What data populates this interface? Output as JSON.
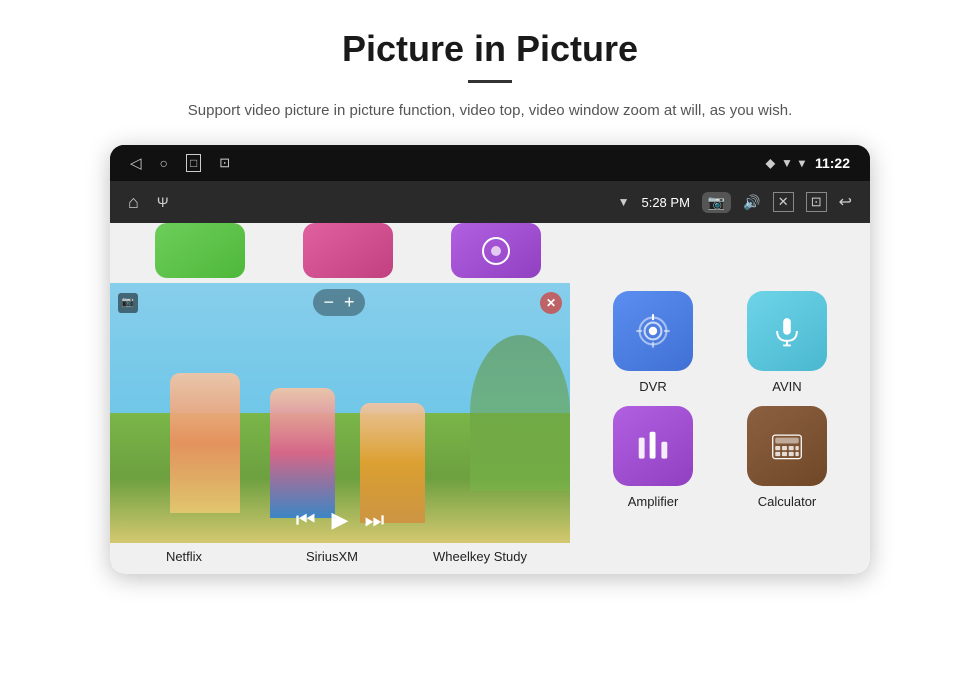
{
  "header": {
    "title": "Picture in Picture",
    "subtitle": "Support video picture in picture function, video top, video window zoom at will, as you wish."
  },
  "statusBar": {
    "time": "11:22",
    "toolbarTime": "5:28 PM"
  },
  "pipControls": {
    "minus": "−",
    "plus": "+",
    "close": "✕"
  },
  "apps": {
    "topRow": [
      {
        "label": "Netflix",
        "color": "green"
      },
      {
        "label": "SiriusXM",
        "color": "pink"
      },
      {
        "label": "Wheelkey Study",
        "color": "purple"
      }
    ],
    "bottomRow": [
      {
        "label": "DVR",
        "color": "dvr"
      },
      {
        "label": "AVIN",
        "color": "avin"
      }
    ],
    "secondBottomRow": [
      {
        "label": "Amplifier",
        "color": "amplifier"
      },
      {
        "label": "Calculator",
        "color": "calculator"
      }
    ]
  },
  "bottomLabels": {
    "netflix": "Netflix",
    "siriusxm": "SiriusXM",
    "wheelkey": "Wheelkey Study",
    "amplifier": "Amplifier",
    "calculator": "Calculator",
    "dvr": "DVR",
    "avin": "AVIN"
  }
}
